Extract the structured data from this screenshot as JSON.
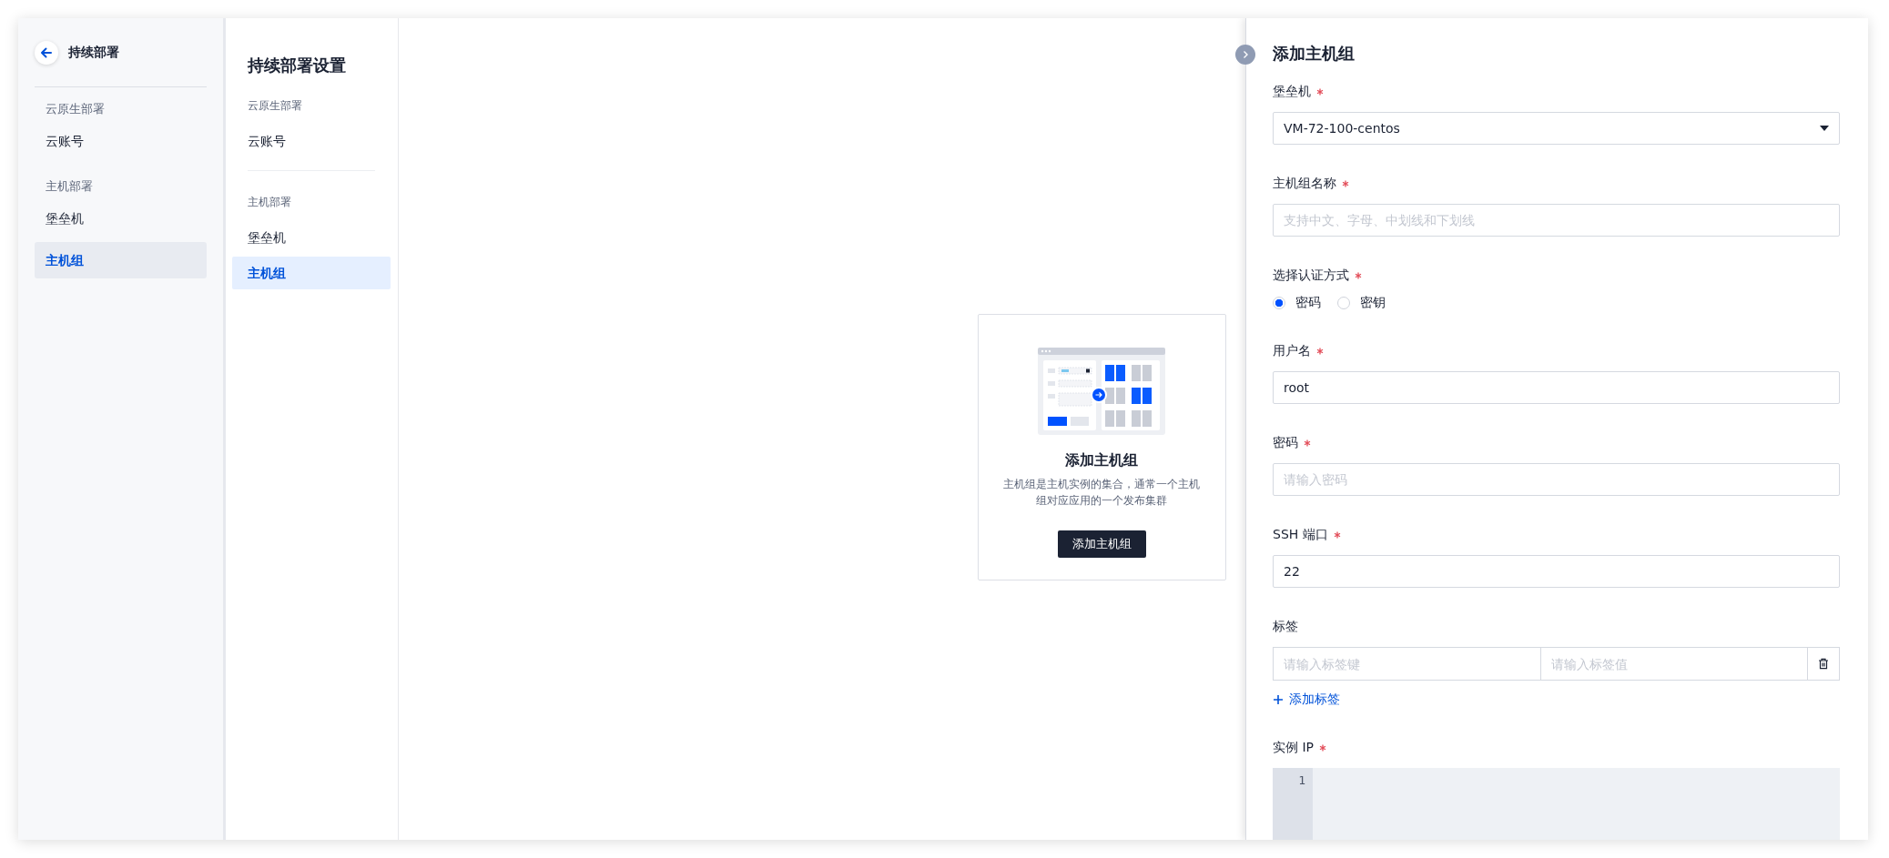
{
  "app_nav": {
    "title": "持续部署",
    "sections": [
      {
        "heading": "云原生部署",
        "items": [
          {
            "label": "云账号",
            "selected": false
          }
        ]
      },
      {
        "heading": "主机部署",
        "items": [
          {
            "label": "堡垒机",
            "selected": false
          },
          {
            "label": "主机组",
            "selected": true
          }
        ]
      }
    ]
  },
  "settings_nav": {
    "title": "持续部署设置",
    "sections": [
      {
        "heading": "云原生部署",
        "items": [
          {
            "label": "云账号",
            "selected": false
          }
        ]
      },
      {
        "heading": "主机部署",
        "items": [
          {
            "label": "堡垒机",
            "selected": false
          },
          {
            "label": "主机组",
            "selected": true
          }
        ]
      }
    ]
  },
  "empty_state": {
    "title": "添加主机组",
    "description": "主机组是主机实例的集合，通常一个主机组对应应用的一个发布集群",
    "button": "添加主机组"
  },
  "drawer": {
    "title": "添加主机组",
    "fields": [
      {
        "kind": "select",
        "label": "堡垒机",
        "required": true,
        "value": "VM-72-100-centos"
      },
      {
        "kind": "input",
        "label": "主机组名称",
        "required": true,
        "placeholder": "支持中文、字母、中划线和下划线"
      },
      {
        "kind": "radio",
        "label": "选择认证方式",
        "required": true,
        "options": [
          {
            "label": "密码",
            "selected": true
          },
          {
            "label": "密钥",
            "selected": false
          }
        ]
      },
      {
        "kind": "input",
        "label": "用户名",
        "required": true,
        "value": "root"
      },
      {
        "kind": "input",
        "label": "密码",
        "required": true,
        "placeholder": "请输入密码"
      },
      {
        "kind": "input",
        "label": "SSH 端口",
        "required": true,
        "value": "22"
      },
      {
        "kind": "tags",
        "label": "标签",
        "required": false,
        "key_placeholder": "请输入标签键",
        "value_placeholder": "请输入标签值",
        "add_label": "添加标签"
      },
      {
        "kind": "code",
        "label": "实例 IP",
        "required": true,
        "line_numbers": [
          "1"
        ]
      }
    ]
  }
}
